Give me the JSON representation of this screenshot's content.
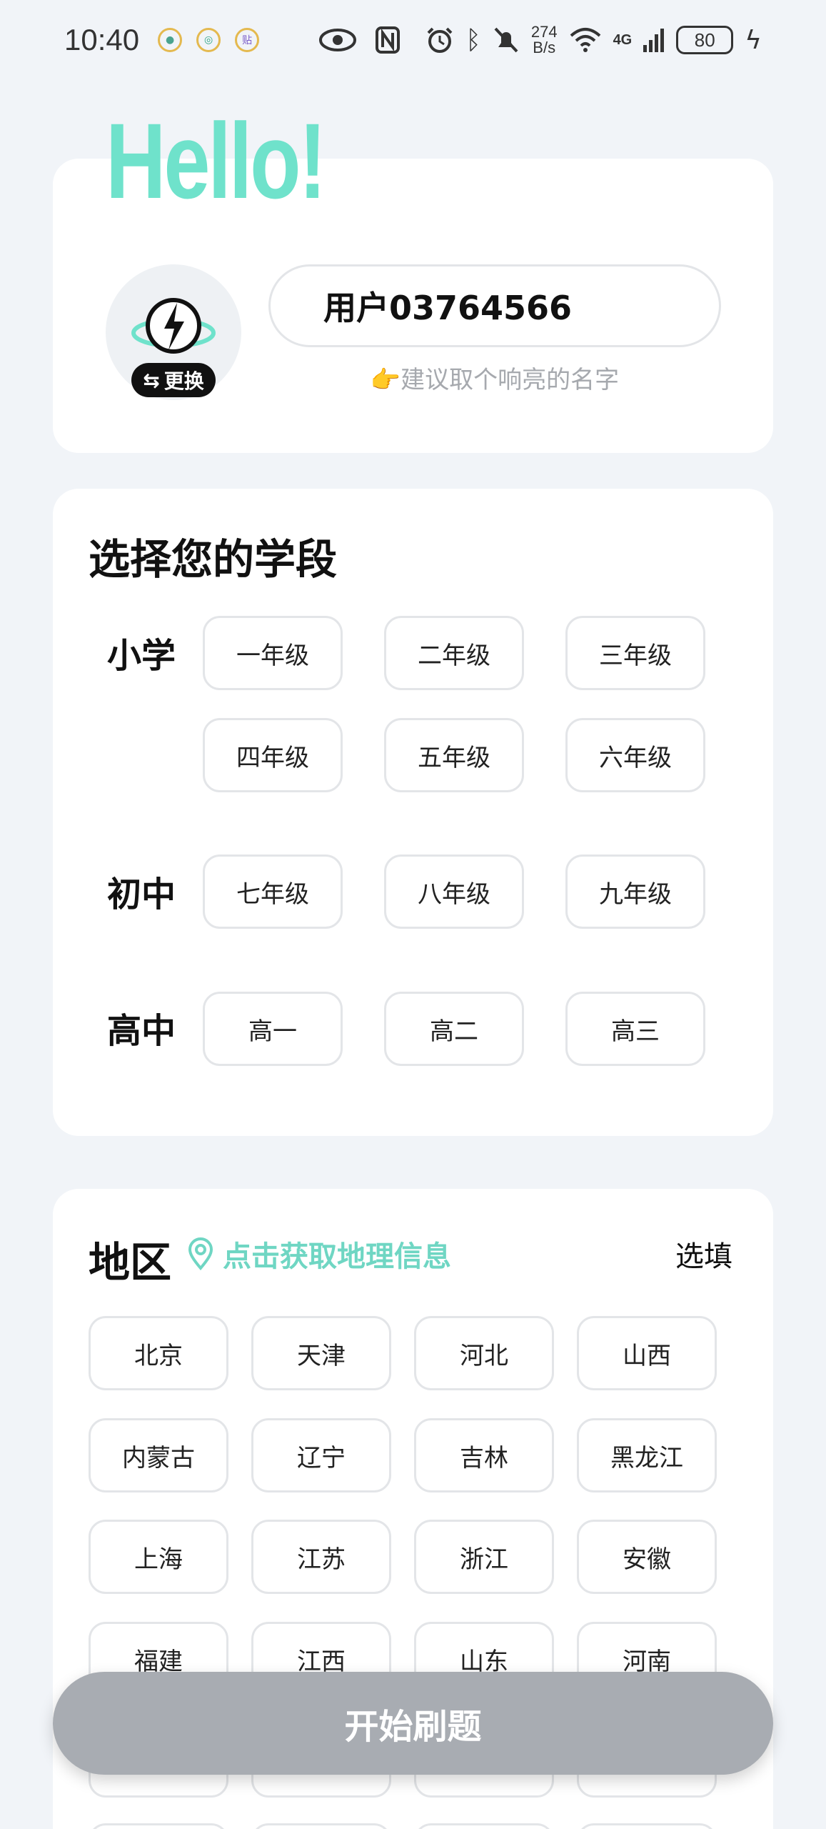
{
  "status_bar": {
    "time": "10:40",
    "app_icons": [
      "app-icon-1",
      "app-icon-2",
      "贴"
    ],
    "speed_top": "274",
    "speed_bottom": "B/s",
    "network": "4G",
    "battery": "80"
  },
  "profile": {
    "hello": "Hello!",
    "change_label": "更换",
    "username": "用户03764566",
    "hint": "👉建议取个响亮的名字"
  },
  "grade": {
    "title": "选择您的学段",
    "primary_label": "小学",
    "primary": [
      "一年级",
      "二年级",
      "三年级",
      "四年级",
      "五年级",
      "六年级"
    ],
    "junior_label": "初中",
    "junior": [
      "七年级",
      "八年级",
      "九年级"
    ],
    "senior_label": "高中",
    "senior": [
      "高一",
      "高二",
      "高三"
    ]
  },
  "region": {
    "title": "地区",
    "locate_label": "点击获取地理信息",
    "optional_label": "选填",
    "provinces": [
      "北京",
      "天津",
      "河北",
      "山西",
      "内蒙古",
      "辽宁",
      "吉林",
      "黑龙江",
      "上海",
      "江苏",
      "浙江",
      "安徽",
      "福建",
      "江西",
      "山东",
      "河南"
    ]
  },
  "start_button": "开始刷题",
  "colors": {
    "accent": "#6fe2cb",
    "button_disabled": "#a8acb2",
    "background": "#f1f4f8"
  }
}
